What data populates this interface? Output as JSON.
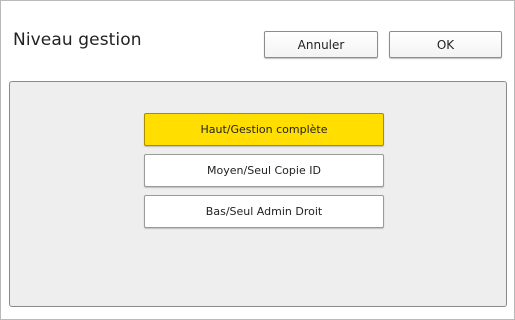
{
  "header": {
    "title": "Niveau gestion",
    "cancel_label": "Annuler",
    "ok_label": "OK"
  },
  "options": [
    {
      "label": "Haut/Gestion complète",
      "selected": true
    },
    {
      "label": "Moyen/Seul Copie ID",
      "selected": false
    },
    {
      "label": "Bas/Seul Admin Droit",
      "selected": false
    }
  ],
  "colors": {
    "selected": "#ffde00",
    "panel": "#eeeeee"
  }
}
